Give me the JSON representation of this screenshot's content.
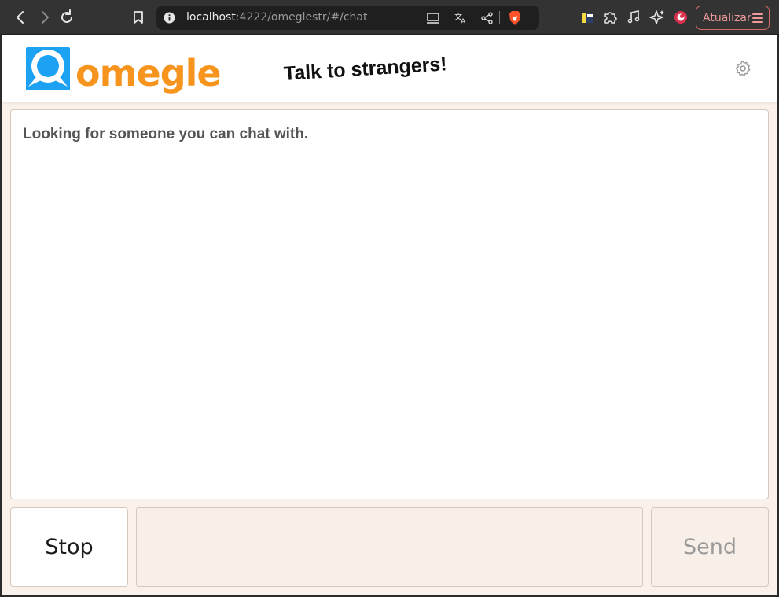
{
  "browser": {
    "url_host": "localhost",
    "url_rest": ":4222/omeglestr/#/chat",
    "update_label": "Atualizar"
  },
  "site": {
    "logo_text": "omegle",
    "tagline": "Talk to strangers!",
    "brand_orange": "#f7941d",
    "brand_blue": "#1da1f2"
  },
  "chat": {
    "status": "Looking for someone you can chat with.",
    "input_value": "",
    "stop_label": "Stop",
    "send_label": "Send"
  }
}
